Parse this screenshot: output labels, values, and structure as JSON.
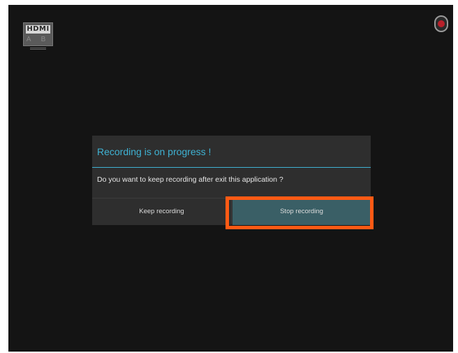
{
  "status_bar": {
    "hdmi_icon": {
      "logo_text": "HDMI",
      "inputs": "A B",
      "icon": "hdmi-input-icon"
    },
    "record_icon": "record-icon",
    "record_color": "#b8202a"
  },
  "dialog": {
    "title": "Recording is on progress !",
    "message": "Do you want to keep recording after exit this application ?",
    "buttons": {
      "keep_label": "Keep recording",
      "stop_label": "Stop recording"
    },
    "accent_color": "#3fb2d3"
  },
  "highlight": {
    "color": "#ff5a14",
    "target": "Stop recording"
  }
}
